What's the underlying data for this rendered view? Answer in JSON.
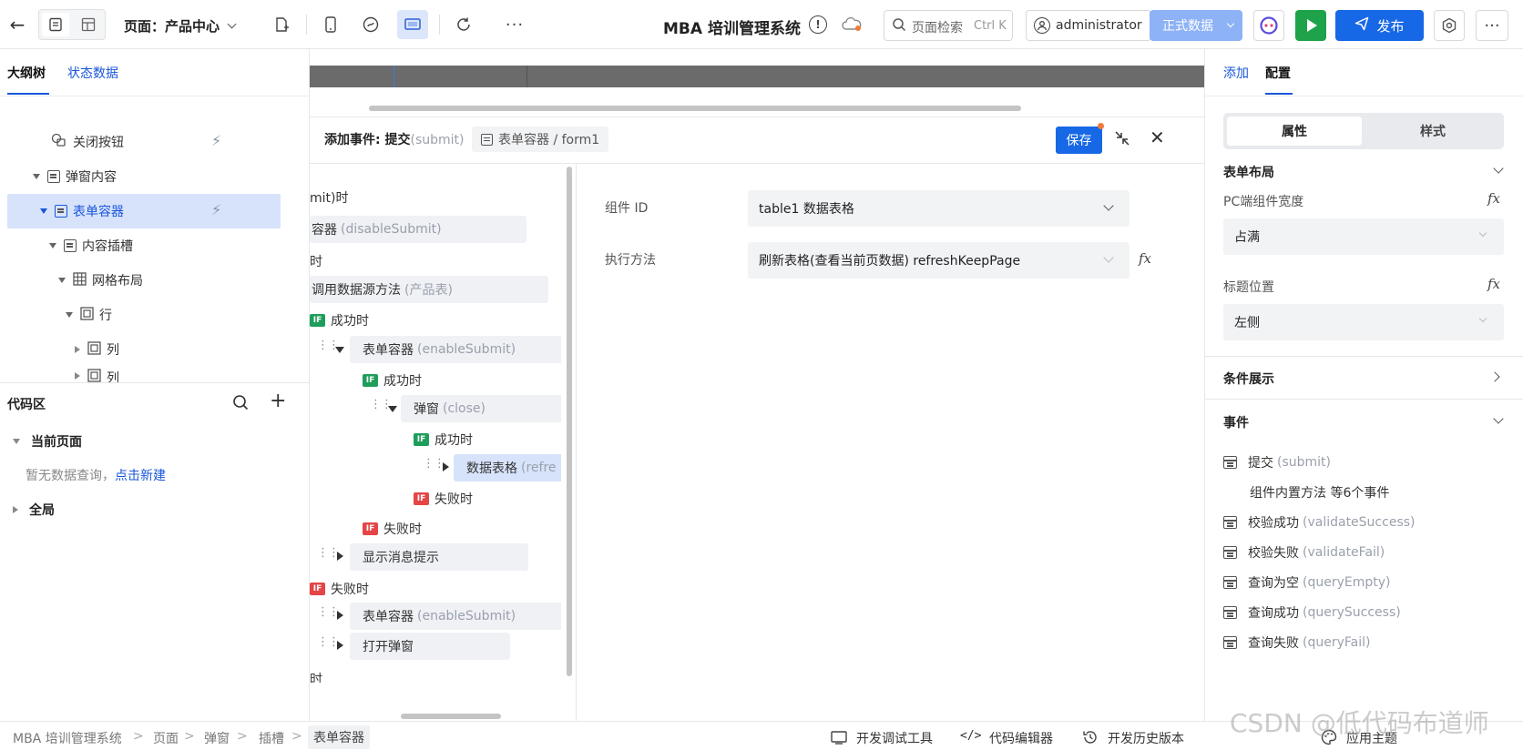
{
  "topbar": {
    "page_label": "页面：产品中心",
    "app_title": "MBA 培训管理系统",
    "search_placeholder": "页面检索",
    "search_shortcut": "Ctrl K",
    "user": "administrator",
    "env_label": "正式数据",
    "publish_label": "发布"
  },
  "left": {
    "tabs": [
      "大纲树",
      "状态数据"
    ],
    "tree": [
      {
        "label": "关闭按钮"
      },
      {
        "label": "弹窗内容"
      },
      {
        "label": "表单容器"
      },
      {
        "label": "内容插槽"
      },
      {
        "label": "网格布局"
      },
      {
        "label": "行"
      },
      {
        "label": "列"
      },
      {
        "label": "列"
      }
    ],
    "code": {
      "title": "代码区",
      "current_page": "当前页面",
      "empty_text": "暂无数据查询，",
      "create_link": "点击新建",
      "global": "全局"
    }
  },
  "editor": {
    "title": "添加事件: 提交",
    "title_sub": "(submit)",
    "path": "表单容器 / form1",
    "save_label": "保存",
    "flow": {
      "l1": "mit)时",
      "l2_main": "容器",
      "l2_sub": "(disableSubmit)",
      "l3": "时",
      "l4_main": "调用数据源方法",
      "l4_sub": "(产品表)",
      "l5": "成功时",
      "l6_main": "表单容器",
      "l6_sub": "(enableSubmit)",
      "l7": "成功时",
      "l8_main": "弹窗",
      "l8_sub": "(close)",
      "l9": "成功时",
      "l10_main": "数据表格",
      "l10_sub": "(refre",
      "l11": "失败时",
      "l12": "失败时",
      "l13": "显示消息提示",
      "l14": "失败时",
      "l15_main": "表单容器",
      "l15_sub": "(enableSubmit)",
      "l16": "打开弹窗",
      "l17": "时",
      "if_badge": "IF"
    },
    "config": {
      "component_label": "组件 ID",
      "component_value": "table1 数据表格",
      "method_label": "执行方法",
      "method_value": "刷新表格(查看当前页数据) refreshKeepPage"
    }
  },
  "right": {
    "tabs": [
      "添加",
      "配置"
    ],
    "seg": [
      "属性",
      "样式"
    ],
    "form_layout": "表单布局",
    "pc_width_label": "PC端组件宽度",
    "pc_width_value": "占满",
    "title_pos_label": "标题位置",
    "title_pos_value": "左侧",
    "cond_display": "条件展示",
    "events_title": "事件",
    "events": [
      {
        "name": "提交",
        "code": "(submit)"
      },
      {
        "name": "组件内置方法 等6个事件",
        "code": ""
      },
      {
        "name": "校验成功",
        "code": "(validateSuccess)"
      },
      {
        "name": "校验失败",
        "code": "(validateFail)"
      },
      {
        "name": "查询为空",
        "code": "(queryEmpty)"
      },
      {
        "name": "查询成功",
        "code": "(querySuccess)"
      },
      {
        "name": "查询失败",
        "code": "(queryFail)"
      }
    ],
    "fx": "fx"
  },
  "status": {
    "crumbs": [
      "MBA 培训管理系统",
      "页面",
      "弹窗",
      "插槽",
      "表单容器"
    ],
    "dev_tools": "开发调试工具",
    "code_editor": "代码编辑器",
    "history": "开发历史版本",
    "theme": "应用主题",
    "watermark": "CSDN @低代码布道师"
  }
}
